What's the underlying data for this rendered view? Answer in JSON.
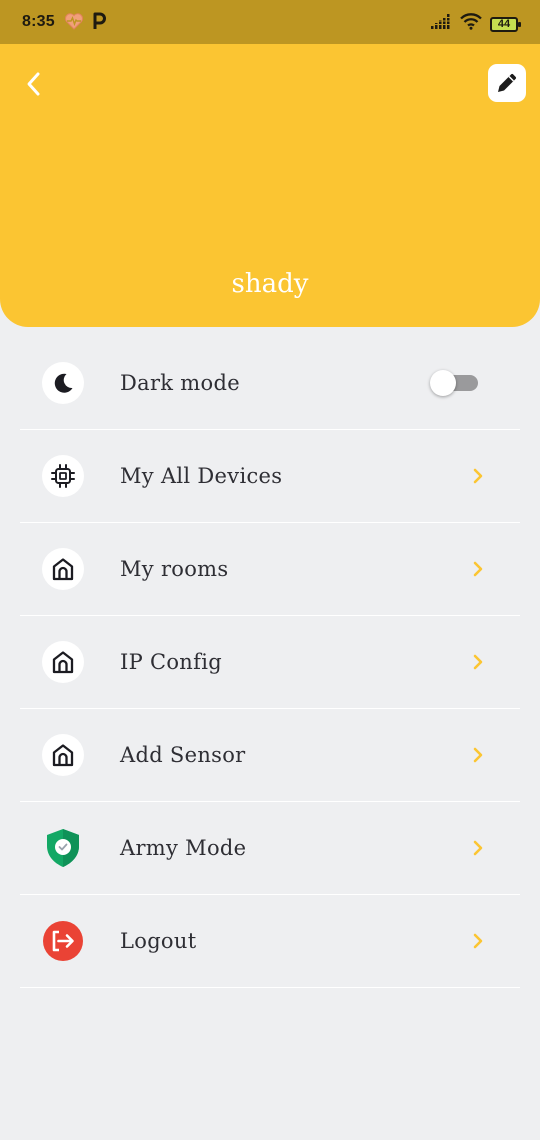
{
  "status_bar": {
    "time": "8:35",
    "battery_level": "44",
    "icons": [
      "heart-rate-icon",
      "p-app-icon",
      "signal-icon",
      "wifi-icon",
      "battery-icon"
    ]
  },
  "header": {
    "profile_name": "shady",
    "background_color": "#fbc532",
    "icons": [
      "back-arrow-icon",
      "edit-pencil-icon"
    ]
  },
  "settings": {
    "dark_mode": {
      "label": "Dark mode",
      "icon": "moon-icon",
      "enabled": false
    },
    "items": [
      {
        "label": "My All Devices",
        "icon": "chip-icon"
      },
      {
        "label": "My rooms",
        "icon": "home-icon"
      },
      {
        "label": "IP Config",
        "icon": "home-icon"
      },
      {
        "label": "Add Sensor",
        "icon": "home-icon"
      },
      {
        "label": "Army Mode",
        "icon": "shield-check-icon"
      },
      {
        "label": "Logout",
        "icon": "logout-icon"
      }
    ],
    "chevron_color": "#fbc532"
  }
}
